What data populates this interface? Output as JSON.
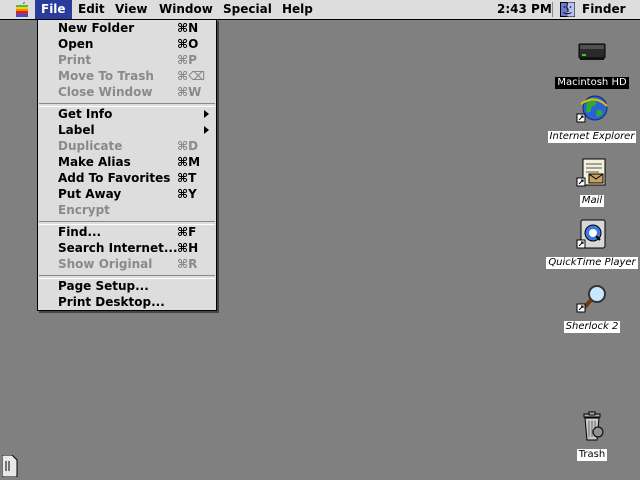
{
  "menubar": {
    "apple_icon": "apple-icon",
    "menus": [
      "File",
      "Edit",
      "View",
      "Window",
      "Special",
      "Help"
    ],
    "active_menu": "File",
    "clock": "2:43 PM",
    "app_name": "Finder",
    "app_icon": "finder-icon"
  },
  "file_menu": {
    "groups": [
      {
        "items": [
          {
            "label": "New Folder",
            "shortcut": "⌘N",
            "enabled": true
          },
          {
            "label": "Open",
            "shortcut": "⌘O",
            "enabled": true
          },
          {
            "label": "Print",
            "shortcut": "⌘P",
            "enabled": false
          },
          {
            "label": "Move To Trash",
            "shortcut": "⌘⌫",
            "enabled": false
          },
          {
            "label": "Close Window",
            "shortcut": "⌘W",
            "enabled": false
          }
        ]
      },
      {
        "items": [
          {
            "label": "Get Info",
            "shortcut": "",
            "submenu": true,
            "enabled": true
          },
          {
            "label": "Label",
            "shortcut": "",
            "submenu": true,
            "enabled": true
          },
          {
            "label": "Duplicate",
            "shortcut": "⌘D",
            "enabled": false
          },
          {
            "label": "Make Alias",
            "shortcut": "⌘M",
            "enabled": true
          },
          {
            "label": "Add To Favorites",
            "shortcut": "⌘T",
            "enabled": true
          },
          {
            "label": "Put Away",
            "shortcut": "⌘Y",
            "enabled": true
          },
          {
            "label": "Encrypt",
            "shortcut": "",
            "enabled": false
          }
        ]
      },
      {
        "items": [
          {
            "label": "Find...",
            "shortcut": "⌘F",
            "enabled": true
          },
          {
            "label": "Search Internet...",
            "shortcut": "⌘H",
            "enabled": true
          },
          {
            "label": "Show Original",
            "shortcut": "⌘R",
            "enabled": false
          }
        ]
      },
      {
        "items": [
          {
            "label": "Page Setup...",
            "shortcut": "",
            "enabled": true
          },
          {
            "label": "Print Desktop...",
            "shortcut": "",
            "enabled": true
          }
        ]
      }
    ]
  },
  "desktop": {
    "icons": [
      {
        "label": "Macintosh HD",
        "icon": "hard-drive-icon",
        "selected": true
      },
      {
        "label": "Internet Explorer",
        "icon": "internet-explorer-icon",
        "alias": true
      },
      {
        "label": "Mail",
        "icon": "mail-icon",
        "alias": true
      },
      {
        "label": "QuickTime Player",
        "icon": "quicktime-icon",
        "alias": true
      },
      {
        "label": "Sherlock 2",
        "icon": "sherlock-icon",
        "alias": true
      },
      {
        "label": "Trash",
        "icon": "trash-icon",
        "alias": false
      }
    ]
  },
  "colors": {
    "desktop": "#808080",
    "menubar": "#dddddd",
    "highlight": "#2a3c9b",
    "disabled_text": "#8a8a8a"
  }
}
